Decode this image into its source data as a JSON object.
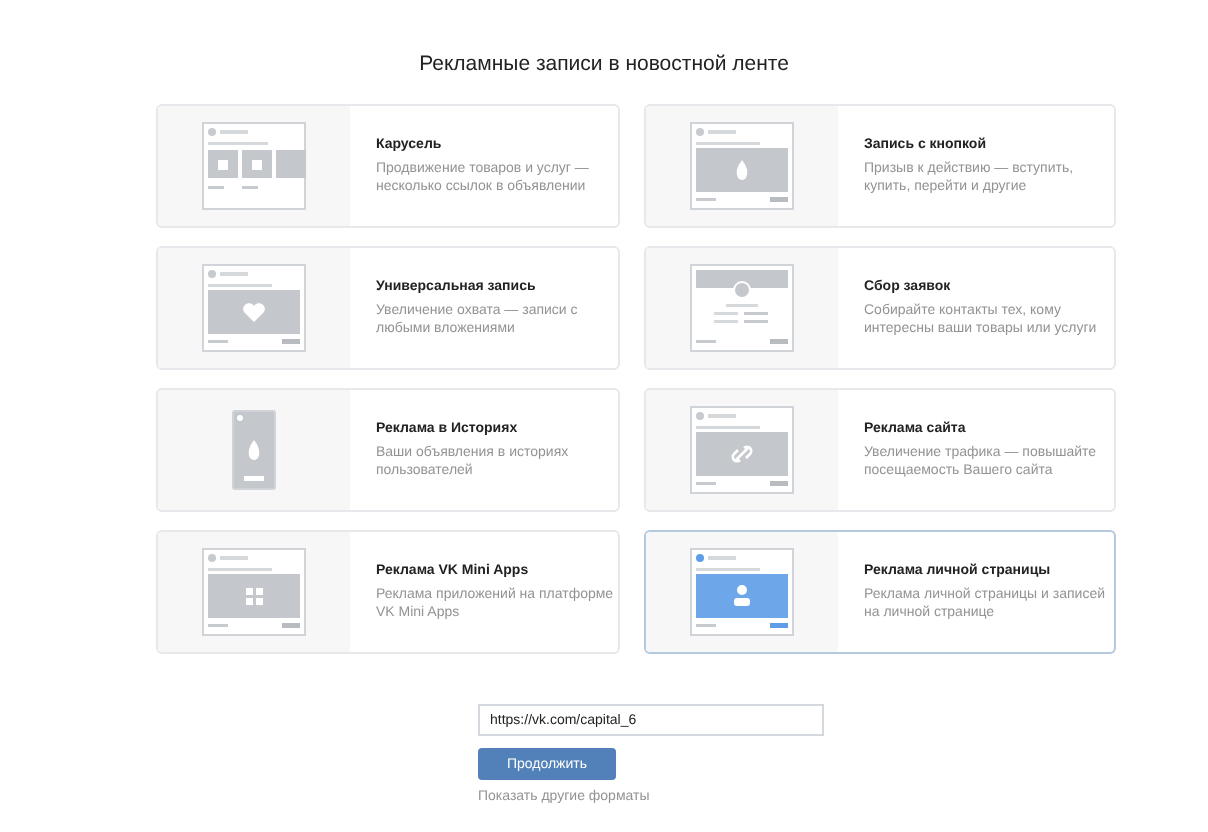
{
  "title": "Рекламные записи в новостной ленте",
  "formats": [
    {
      "kind": "carousel",
      "name": "Карусель",
      "description": "Продвижение товаров и услуг — несколько ссылок в объявлении",
      "selected": false
    },
    {
      "kind": "button",
      "name": "Запись с кнопкой",
      "description": "Призыв к действию — вступить, купить, перейти и другие",
      "selected": false
    },
    {
      "kind": "universal",
      "name": "Универсальная запись",
      "description": "Увеличение охвата — записи с любыми вложениями",
      "selected": false
    },
    {
      "kind": "form",
      "name": "Сбор заявок",
      "description": "Собирайте контакты тех, кому интересны ваши товары или услуги",
      "selected": false
    },
    {
      "kind": "story",
      "name": "Реклама в Историях",
      "description": "Ваши объявления в историях пользователей",
      "selected": false
    },
    {
      "kind": "site",
      "name": "Реклама сайта",
      "description": "Увеличение трафика — повышайте посещаемость Вашего сайта",
      "selected": false
    },
    {
      "kind": "miniapp",
      "name": "Реклама VK Mini Apps",
      "description": "Реклама приложений на платформе VK Mini Apps",
      "selected": false
    },
    {
      "kind": "profile",
      "name": "Реклама личной страницы",
      "description": "Реклама личной страницы и записей на личной странице",
      "selected": true
    }
  ],
  "url_field": {
    "value": "https://vk.com/capital_6"
  },
  "continue_button": "Продолжить",
  "other_formats_link": "Показать другие форматы"
}
